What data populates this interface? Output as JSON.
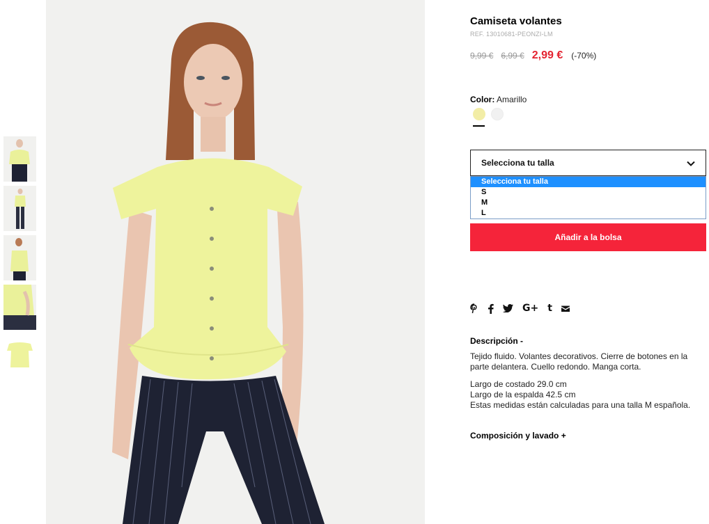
{
  "product": {
    "title": "Camiseta volantes",
    "ref": "REF. 13010681-PEONZI-LM",
    "price_original": "9,99 €",
    "price_previous": "6,99 €",
    "price_sale": "2,99 €",
    "discount": "(-70%)"
  },
  "color": {
    "label": "Color:",
    "value": "Amarillo",
    "swatches": [
      {
        "name": "Amarillo",
        "hex": "#f2eda6",
        "selected": true
      },
      {
        "name": "Blanco",
        "hex": "#f1f1f1",
        "selected": false
      }
    ]
  },
  "size": {
    "select_label": "Selecciona tu talla",
    "options": [
      "Selecciona tu talla",
      "S",
      "M",
      "L"
    ],
    "highlighted_option": "Selecciona tu talla"
  },
  "cart": {
    "add_label": "Añadir a la bolsa"
  },
  "share": {
    "icons": [
      "pinterest-icon",
      "facebook-icon",
      "twitter-icon",
      "google-plus-icon",
      "tumblr-icon",
      "email-icon"
    ]
  },
  "description": {
    "title": "Descripción -",
    "paragraph1": "Tejido fluido. Volantes decorativos. Cierre de botones en la parte delantera. Cuello redondo. Manga corta.",
    "lines": [
      "Largo de costado 29.0 cm",
      "Largo de la espalda 42.5 cm",
      "Estas medidas están calculadas para una talla M española."
    ]
  },
  "composition": {
    "title": "Composición y lavado +"
  },
  "colors": {
    "accent": "#f5243a",
    "sale_price": "#e42330",
    "dropdown_highlight": "#1e90ff"
  },
  "thumbnails": {
    "count": 5,
    "selected": 0
  }
}
